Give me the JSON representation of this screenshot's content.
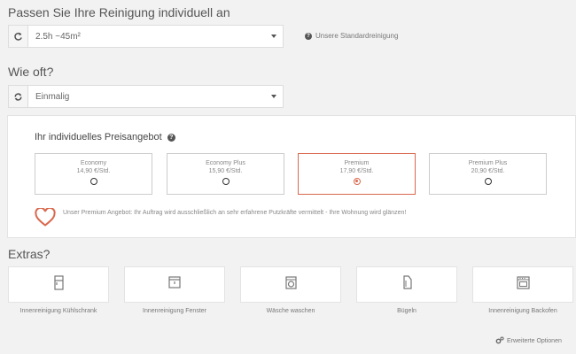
{
  "section1": {
    "heading": "Passen Sie Ihre Reinigung individuell an",
    "select_value": "2.5h ~45m²",
    "help_link": "Unsere Standardreinigung"
  },
  "section2": {
    "heading": "Wie oft?",
    "select_value": "Einmalig"
  },
  "pricing": {
    "title": "Ihr individuelles Preisangebot",
    "plans": [
      {
        "name": "Economy",
        "price": "14,90 €/Std.",
        "selected": false
      },
      {
        "name": "Economy Plus",
        "price": "15,90 €/Std.",
        "selected": false
      },
      {
        "name": "Premium",
        "price": "17,90 €/Std.",
        "selected": true
      },
      {
        "name": "Premium Plus",
        "price": "20,90 €/Std.",
        "selected": false
      }
    ],
    "promo_text": "Unser Premium Angebot: Ihr Auftrag wird ausschließlich an sehr erfahrene Putzkräfte vermittelt - Ihre Wohnung wird glänzen!"
  },
  "extras": {
    "heading": "Extras?",
    "items": [
      {
        "label": "Innenreinigung Kühlschrank",
        "icon": "fridge-icon"
      },
      {
        "label": "Innenreinigung Fenster",
        "icon": "window-icon"
      },
      {
        "label": "Wäsche waschen",
        "icon": "washing-machine-icon"
      },
      {
        "label": "Bügeln",
        "icon": "iron-icon"
      },
      {
        "label": "Innenreinigung Backofen",
        "icon": "oven-icon"
      }
    ]
  },
  "advanced_options": "Erweiterte Optionen",
  "colors": {
    "accent": "#d9684d"
  }
}
